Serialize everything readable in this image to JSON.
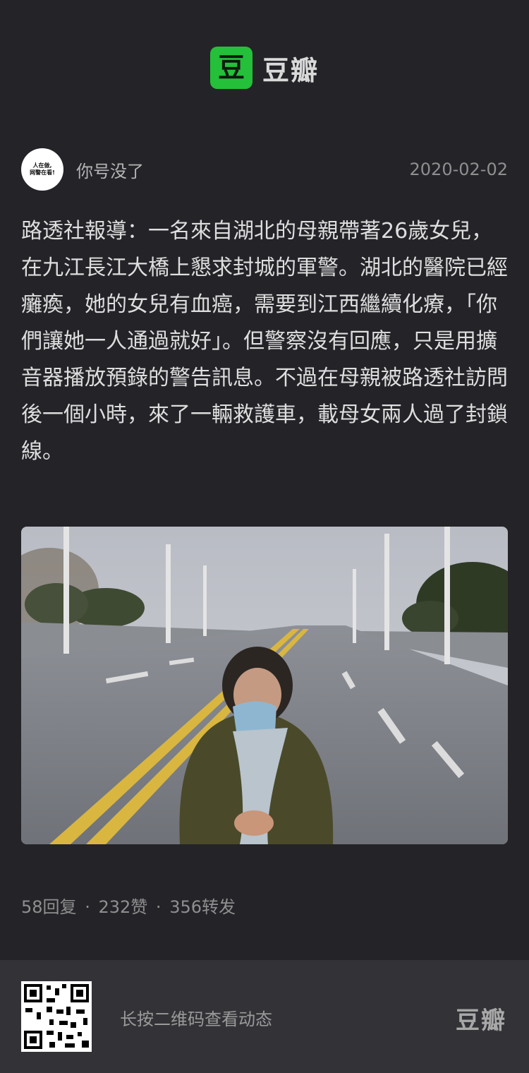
{
  "header": {
    "logo_glyph": "豆",
    "app_name": "豆瓣",
    "brand_color": "#24c03a"
  },
  "author": {
    "avatar_text_line1": "人在做,",
    "avatar_text_line2": "网警在看!",
    "name": "你号没了",
    "date": "2020-02-02"
  },
  "post": {
    "text": "路透社報導：一名來自湖北的母親帶著26歲女兒，在九江長江大橋上懇求封城的軍警。湖北的醫院已經癱瘓，她的女兒有血癌，需要到江西繼續化療，「你們讓她一人通過就好」。但警察沒有回應，只是用擴音器播放預錄的警告訊息。不過在母親被路透社訪問後一個小時，來了一輛救護車，載母女兩人過了封鎖線。"
  },
  "stats": {
    "replies": "58回复",
    "likes": "232赞",
    "reposts": "356转发",
    "separator": "·"
  },
  "footer": {
    "hint": "长按二维码查看动态",
    "logo_text": "豆瓣"
  }
}
